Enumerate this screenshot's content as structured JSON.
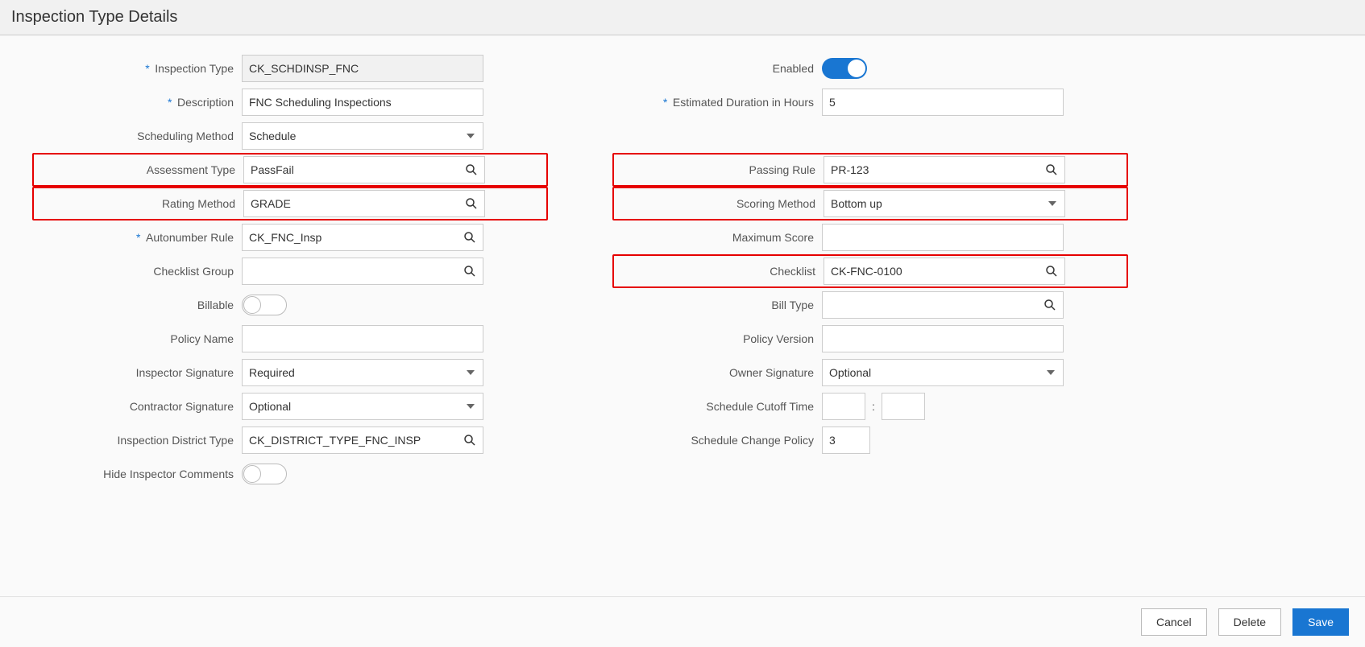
{
  "header": {
    "title": "Inspection Type Details"
  },
  "left": {
    "inspection_type": {
      "label": "Inspection Type",
      "value": "CK_SCHDINSP_FNC",
      "required": true
    },
    "description": {
      "label": "Description",
      "value": "FNC Scheduling Inspections",
      "required": true
    },
    "scheduling_method": {
      "label": "Scheduling Method",
      "value": "Schedule"
    },
    "assessment_type": {
      "label": "Assessment Type",
      "value": "PassFail"
    },
    "rating_method": {
      "label": "Rating Method",
      "value": "GRADE"
    },
    "autonumber_rule": {
      "label": "Autonumber Rule",
      "value": "CK_FNC_Insp",
      "required": true
    },
    "checklist_group": {
      "label": "Checklist Group",
      "value": ""
    },
    "billable": {
      "label": "Billable",
      "on": false
    },
    "policy_name": {
      "label": "Policy Name",
      "value": ""
    },
    "inspector_signature": {
      "label": "Inspector Signature",
      "value": "Required"
    },
    "contractor_signature": {
      "label": "Contractor Signature",
      "value": "Optional"
    },
    "inspection_district_type": {
      "label": "Inspection District Type",
      "value": "CK_DISTRICT_TYPE_FNC_INSP"
    },
    "hide_inspector_comments": {
      "label": "Hide Inspector Comments",
      "on": false
    }
  },
  "right": {
    "enabled": {
      "label": "Enabled",
      "on": true
    },
    "estimated_duration": {
      "label": "Estimated Duration in Hours",
      "value": "5",
      "required": true
    },
    "passing_rule": {
      "label": "Passing Rule",
      "value": "PR-123"
    },
    "scoring_method": {
      "label": "Scoring Method",
      "value": "Bottom up"
    },
    "maximum_score": {
      "label": "Maximum Score",
      "value": ""
    },
    "checklist": {
      "label": "Checklist",
      "value": "CK-FNC-0100"
    },
    "bill_type": {
      "label": "Bill Type",
      "value": ""
    },
    "policy_version": {
      "label": "Policy Version",
      "value": ""
    },
    "owner_signature": {
      "label": "Owner Signature",
      "value": "Optional"
    },
    "schedule_cutoff_time": {
      "label": "Schedule Cutoff Time",
      "hh": "",
      "mm": "",
      "sep": ":"
    },
    "schedule_change_policy": {
      "label": "Schedule Change Policy",
      "value": "3"
    }
  },
  "footer": {
    "cancel": "Cancel",
    "delete": "Delete",
    "save": "Save"
  }
}
